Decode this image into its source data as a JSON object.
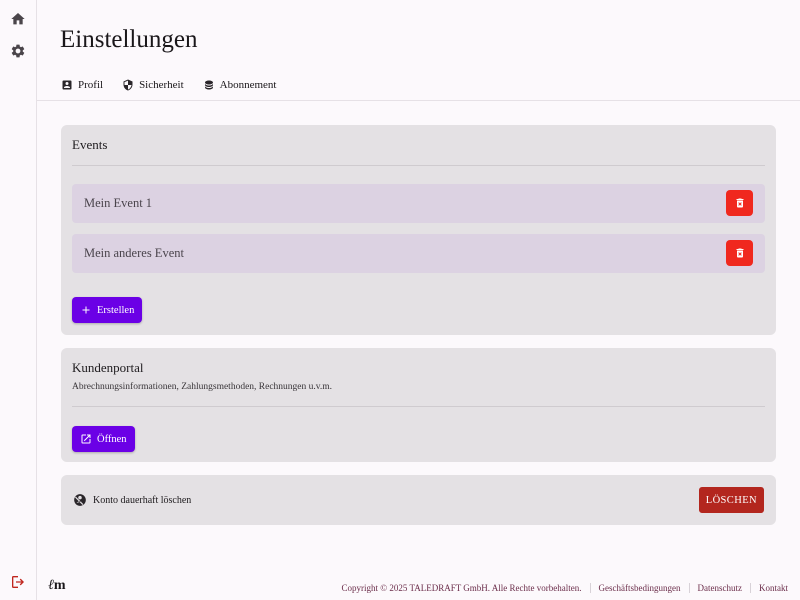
{
  "sidebar": {
    "icons": [
      "home-icon",
      "gear-icon",
      "logout-icon"
    ]
  },
  "header": {
    "title": "Einstellungen",
    "tabs": [
      {
        "label": "Profil",
        "icon": "account-box-icon"
      },
      {
        "label": "Sicherheit",
        "icon": "shield-icon"
      },
      {
        "label": "Abonnement",
        "icon": "database-icon"
      }
    ]
  },
  "events": {
    "title": "Events",
    "items": [
      {
        "name": "Mein Event 1"
      },
      {
        "name": "Mein anderes Event"
      }
    ],
    "create_label": "Erstellen"
  },
  "portal": {
    "title": "Kundenportal",
    "description": "Abrechnungsinformationen, Zahlungsmethoden, Rechnungen u.v.m.",
    "open_label": "Öffnen"
  },
  "account": {
    "delete_text": "Konto dauerhaft löschen",
    "delete_button": "LÖSCHEN"
  },
  "footer": {
    "logo_l": "ℓ",
    "logo_m": "m",
    "copyright": "Copyright © 2025 TALEDRAFT GmbH. Alle Rechte vorbehalten.",
    "links": [
      "Geschäftsbedingungen",
      "Datenschutz",
      "Kontakt"
    ]
  },
  "colors": {
    "accent": "#6b00e6",
    "danger": "#f0281e",
    "danger_dark": "#b3261e",
    "card_bg": "#e4e1e4",
    "event_row_bg": "#dcd2e2",
    "footer_link": "#6b2d4a"
  }
}
